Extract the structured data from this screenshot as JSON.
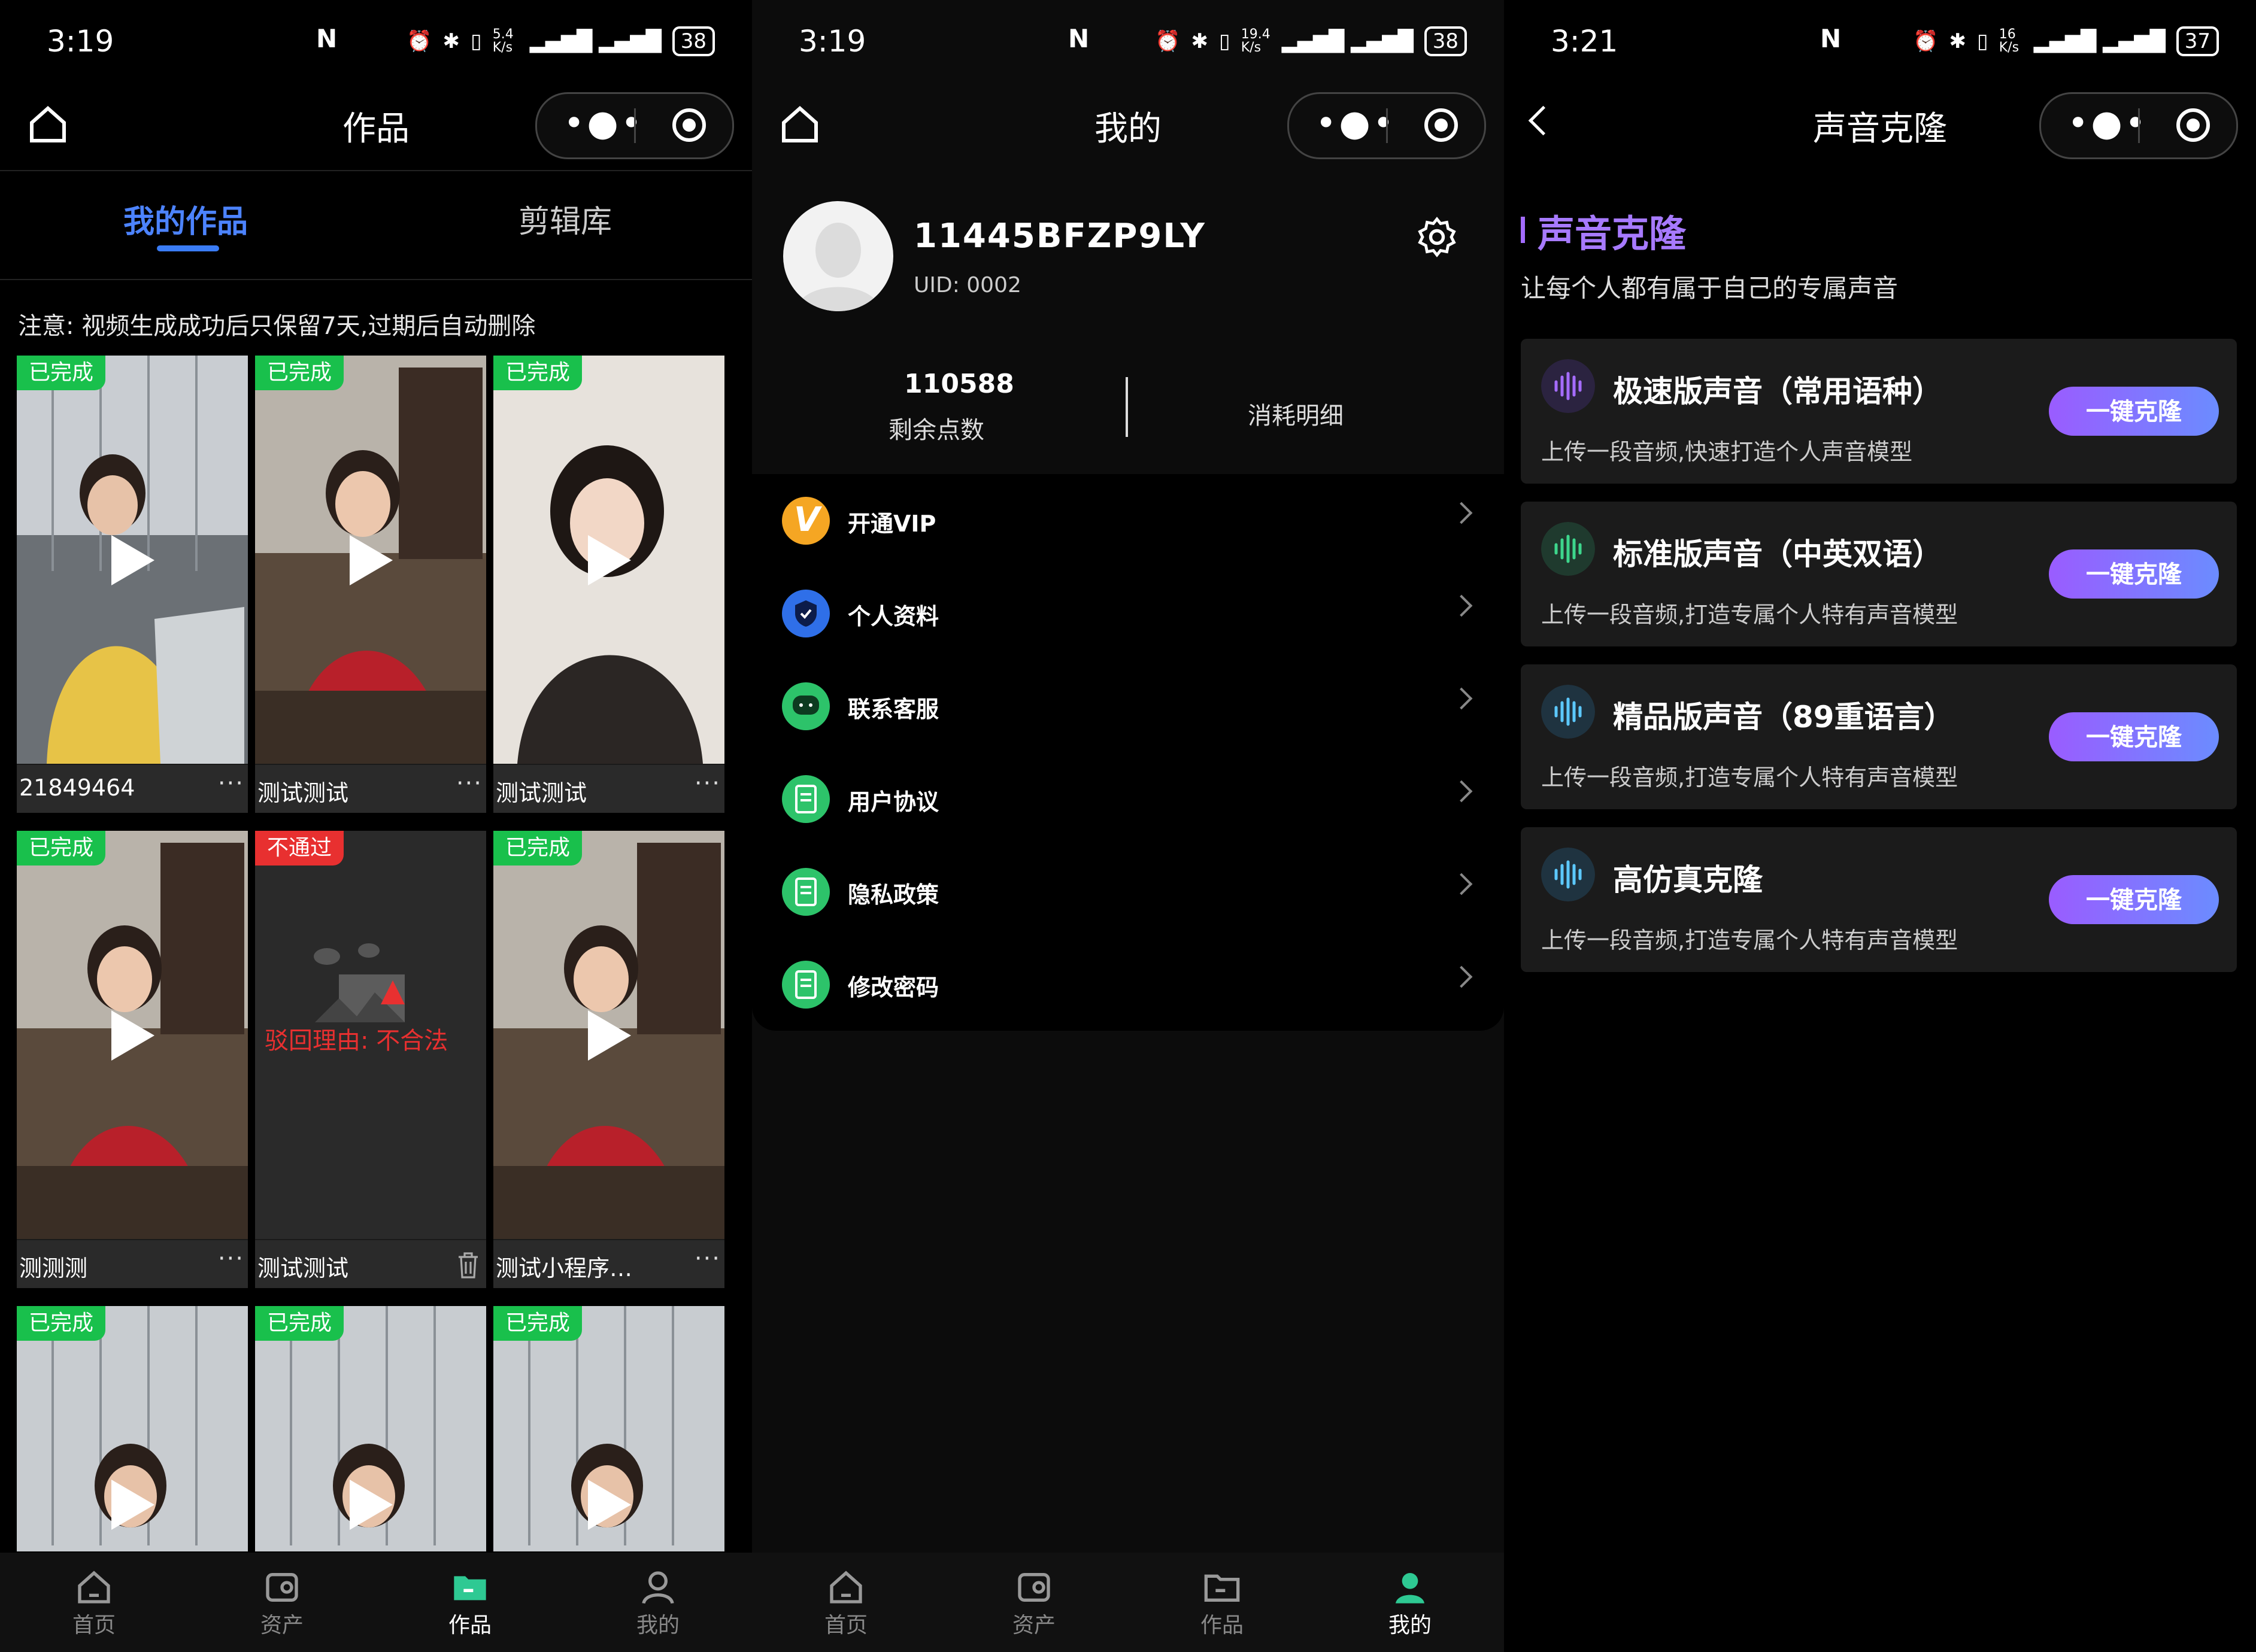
{
  "status": {
    "s1_time": "3:19",
    "s1_speed": "5.4 K/s",
    "s1_battery": "38",
    "s2_time": "3:19",
    "s2_speed": "19.4 K/s",
    "s2_battery": "38",
    "s3_time": "3:21",
    "s3_speed": "16 K/s",
    "s3_battery": "37"
  },
  "tabbar": {
    "home": "首页",
    "assets": "资产",
    "works": "作品",
    "mine": "我的"
  },
  "works": {
    "title": "作品",
    "tab_mine": "我的作品",
    "tab_library": "剪辑库",
    "notice": "注意: 视频生成成功后只保留7天,过期后自动删除",
    "items": [
      {
        "status": "已完成",
        "name": "21849464"
      },
      {
        "status": "已完成",
        "name": "测试测试"
      },
      {
        "status": "已完成",
        "name": "测试测试"
      },
      {
        "status": "已完成",
        "name": "测测测"
      },
      {
        "status": "不通过",
        "name": "测试测试",
        "reject": "驳回理由: 不合法"
      },
      {
        "status": "已完成",
        "name": "测试小程序…"
      },
      {
        "status": "已完成",
        "name": ""
      },
      {
        "status": "已完成",
        "name": ""
      },
      {
        "status": "已完成",
        "name": ""
      }
    ],
    "more": "···"
  },
  "mine": {
    "title": "我的",
    "username": "11445BFZP9LY",
    "uid": "UID:  0002",
    "points_value": "110588",
    "points_label": "剩余点数",
    "consume_label": "消耗明细",
    "menu": [
      {
        "label": "开通VIP",
        "color": "#f5a623"
      },
      {
        "label": "个人资料",
        "color": "#2f6fe8"
      },
      {
        "label": "联系客服",
        "color": "#2dc36a"
      },
      {
        "label": "用户协议",
        "color": "#2dc36a"
      },
      {
        "label": "隐私政策",
        "color": "#2dc36a"
      },
      {
        "label": "修改密码",
        "color": "#2dc36a"
      }
    ]
  },
  "clone": {
    "title": "声音克隆",
    "heading": "声音克隆",
    "subtitle": "让每个人都有属于自己的专属声音",
    "button": "一键克隆",
    "cards": [
      {
        "title": "极速版声音（常用语种）",
        "desc": "上传一段音频,快速打造个人声音模型",
        "color": "#a56cff"
      },
      {
        "title": "标准版声音（中英双语）",
        "desc": "上传一段音频,打造专属个人特有声音模型",
        "color": "#3dd68c"
      },
      {
        "title": "精品版声音（89重语言）",
        "desc": "上传一段音频,打造专属个人特有声音模型",
        "color": "#5cc8ff"
      },
      {
        "title": "高仿真克隆",
        "desc": "上传一段音频,打造专属个人特有声音模型",
        "color": "#5cc8ff"
      }
    ]
  }
}
